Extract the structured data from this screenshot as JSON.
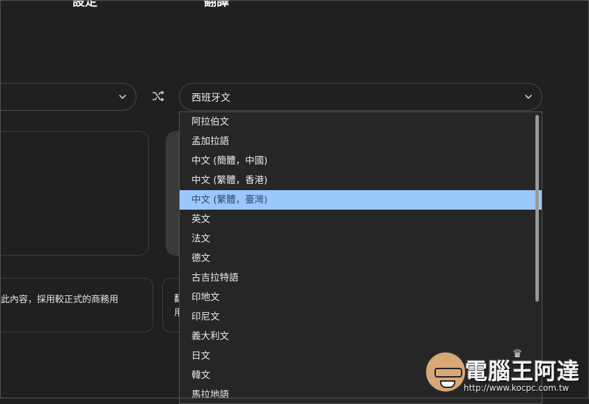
{
  "header": {
    "label_left": "設定",
    "label_right": "翻譯"
  },
  "source": {
    "selected": ""
  },
  "target": {
    "selected": "西班牙文"
  },
  "dropdown": {
    "options": [
      "阿拉伯文",
      "孟加拉語",
      "中文 (簡體，中國)",
      "中文 (繁體，香港)",
      "中文 (繁體，臺灣)",
      "英文",
      "法文",
      "德文",
      "古吉拉特語",
      "印地文",
      "印尼文",
      "義大利文",
      "日文",
      "韓文",
      "馬拉地語"
    ],
    "highlighted_index": 4,
    "highlight_color": "#99c8ff"
  },
  "suggestion": {
    "text": "此內容，採用較正式的商務用",
    "second_line1": "翻",
    "second_line2": "用"
  },
  "watermark": {
    "brand": "電腦王阿達",
    "url": "http://www.kocpc.com.tw"
  }
}
